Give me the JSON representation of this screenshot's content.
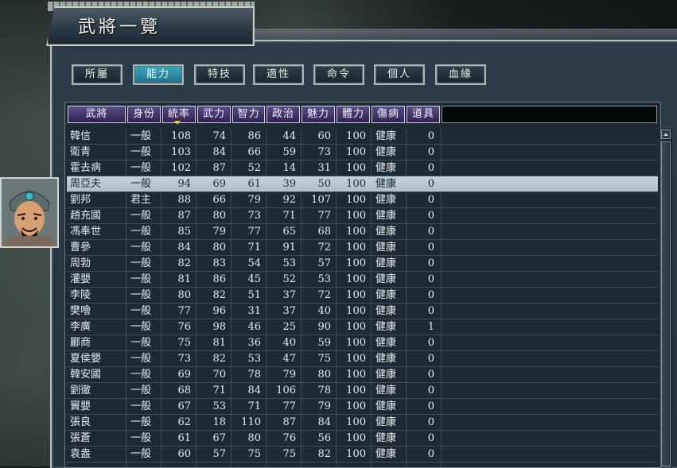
{
  "window": {
    "title": "武將一覽"
  },
  "tabs": [
    {
      "label": "所屬",
      "active": false
    },
    {
      "label": "能力",
      "active": true
    },
    {
      "label": "特技",
      "active": false
    },
    {
      "label": "適性",
      "active": false
    },
    {
      "label": "命令",
      "active": false
    },
    {
      "label": "個人",
      "active": false
    },
    {
      "label": "血緣",
      "active": false
    }
  ],
  "columns": [
    "武將",
    "身份",
    "統率",
    "武力",
    "智力",
    "政治",
    "魅力",
    "體力",
    "傷病",
    "道具"
  ],
  "sorted_column": "統率",
  "selected_row": "周亞夫",
  "rows": [
    [
      "韓信",
      "一般",
      "108",
      "74",
      "86",
      "44",
      "60",
      "100",
      "健康",
      "0"
    ],
    [
      "衛青",
      "一般",
      "103",
      "84",
      "66",
      "59",
      "73",
      "100",
      "健康",
      "0"
    ],
    [
      "霍去病",
      "一般",
      "102",
      "87",
      "52",
      "14",
      "31",
      "100",
      "健康",
      "0"
    ],
    [
      "周亞夫",
      "一般",
      "94",
      "69",
      "61",
      "39",
      "50",
      "100",
      "健康",
      "0"
    ],
    [
      "劉邦",
      "君主",
      "88",
      "66",
      "79",
      "92",
      "107",
      "100",
      "健康",
      "0"
    ],
    [
      "趙充國",
      "一般",
      "87",
      "80",
      "73",
      "71",
      "77",
      "100",
      "健康",
      "0"
    ],
    [
      "馮奉世",
      "一般",
      "85",
      "79",
      "77",
      "65",
      "68",
      "100",
      "健康",
      "0"
    ],
    [
      "曹參",
      "一般",
      "84",
      "80",
      "71",
      "91",
      "72",
      "100",
      "健康",
      "0"
    ],
    [
      "周勃",
      "一般",
      "82",
      "83",
      "54",
      "53",
      "57",
      "100",
      "健康",
      "0"
    ],
    [
      "灌嬰",
      "一般",
      "81",
      "86",
      "45",
      "52",
      "53",
      "100",
      "健康",
      "0"
    ],
    [
      "李陵",
      "一般",
      "80",
      "82",
      "51",
      "37",
      "72",
      "100",
      "健康",
      "0"
    ],
    [
      "樊噲",
      "一般",
      "77",
      "96",
      "31",
      "37",
      "40",
      "100",
      "健康",
      "0"
    ],
    [
      "李廣",
      "一般",
      "76",
      "98",
      "46",
      "25",
      "90",
      "100",
      "健康",
      "1"
    ],
    [
      "酈商",
      "一般",
      "75",
      "81",
      "36",
      "40",
      "59",
      "100",
      "健康",
      "0"
    ],
    [
      "夏侯嬰",
      "一般",
      "73",
      "82",
      "53",
      "47",
      "75",
      "100",
      "健康",
      "0"
    ],
    [
      "韓安國",
      "一般",
      "69",
      "70",
      "78",
      "79",
      "80",
      "100",
      "健康",
      "0"
    ],
    [
      "劉徹",
      "一般",
      "68",
      "71",
      "84",
      "106",
      "78",
      "100",
      "健康",
      "0"
    ],
    [
      "竇嬰",
      "一般",
      "67",
      "53",
      "71",
      "77",
      "79",
      "100",
      "健康",
      "0"
    ],
    [
      "張良",
      "一般",
      "62",
      "18",
      "110",
      "87",
      "84",
      "100",
      "健康",
      "0"
    ],
    [
      "張蒼",
      "一般",
      "61",
      "67",
      "80",
      "76",
      "56",
      "100",
      "健康",
      "0"
    ],
    [
      "袁盎",
      "一般",
      "60",
      "57",
      "75",
      "75",
      "82",
      "100",
      "健康",
      "0"
    ]
  ],
  "colors": {
    "tab_active": "#2f8aa4",
    "header_bg": "#4a3c76",
    "selected_row": "#bccdd6",
    "panel_bg": "#283846"
  }
}
